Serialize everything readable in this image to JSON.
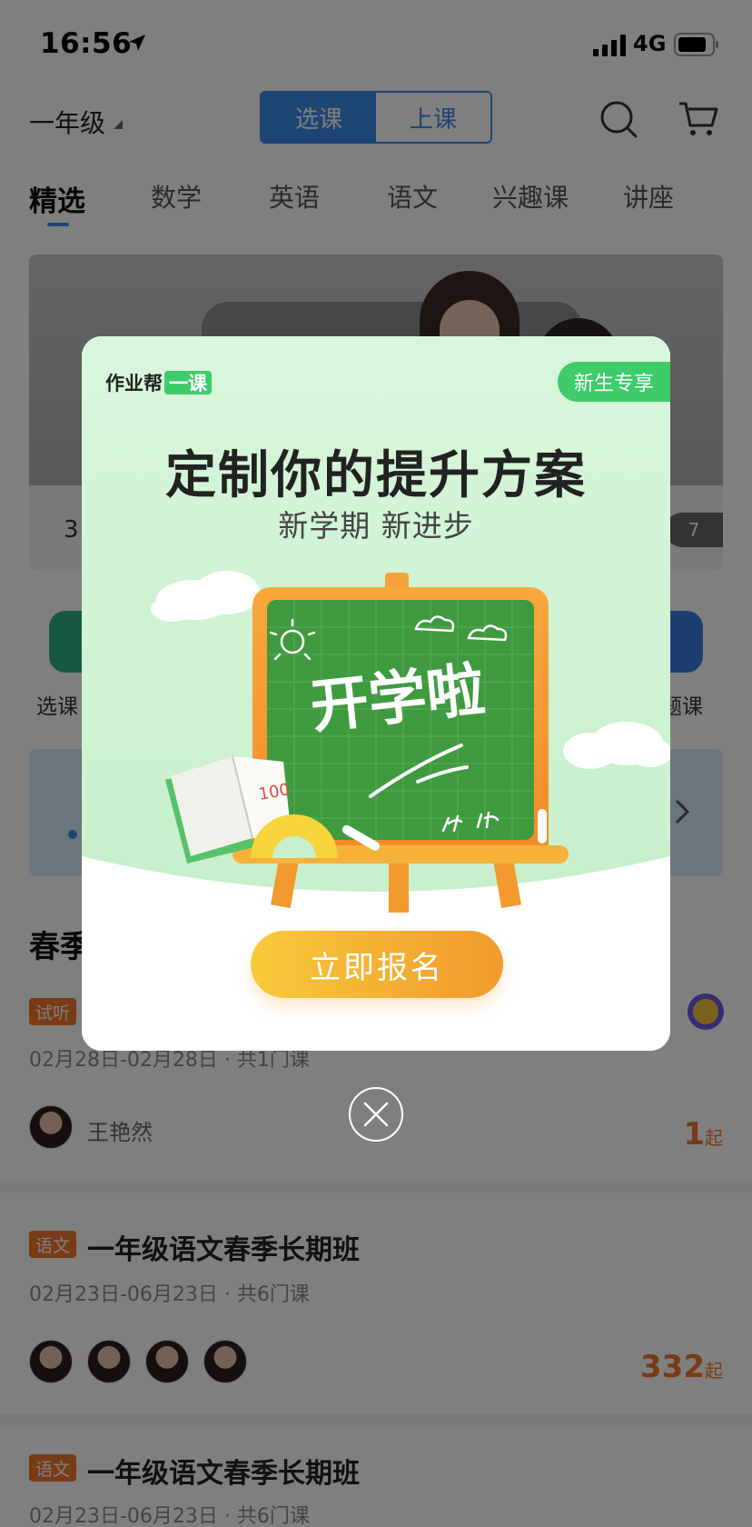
{
  "status_bar": {
    "time": "16:56",
    "network": "4G"
  },
  "header": {
    "grade": "一年级",
    "segments": [
      "选课",
      "上课"
    ]
  },
  "tabs": [
    "精选",
    "数学",
    "英语",
    "语文",
    "兴趣课",
    "讲座"
  ],
  "banner": {
    "caption_visible": "3",
    "pager_visible": "7"
  },
  "quick": {
    "left_label": "选课",
    "right_label": "题课"
  },
  "section": {
    "title_visible": "春季"
  },
  "courses": [
    {
      "tag": "试听",
      "date": "02月28日-02月28日 · 共1门课",
      "teacher": "王艳然",
      "price": "1",
      "price_suffix": "起"
    },
    {
      "tag": "语文",
      "title": "一年级语文春季长期班",
      "date": "02月23日-06月23日 · 共6门课",
      "price": "332",
      "price_suffix": "起"
    },
    {
      "tag": "语文",
      "title": "一年级语文春季长期班",
      "date": "02月23日-06月23日 · 共6门课"
    }
  ],
  "popup": {
    "brand": "作业帮",
    "brand_suffix": "一课",
    "badge": "新生专享",
    "title": "定制你的提升方案",
    "subtitle": "新学期 新进步",
    "board_text": "开学啦",
    "book_score": "100",
    "cta": "立即报名"
  },
  "colors": {
    "accent_blue": "#3b8ae6",
    "accent_green": "#3ecb6a",
    "price_orange": "#f2772e",
    "cta_start": "#f7c93a",
    "cta_end": "#f29a2e"
  }
}
